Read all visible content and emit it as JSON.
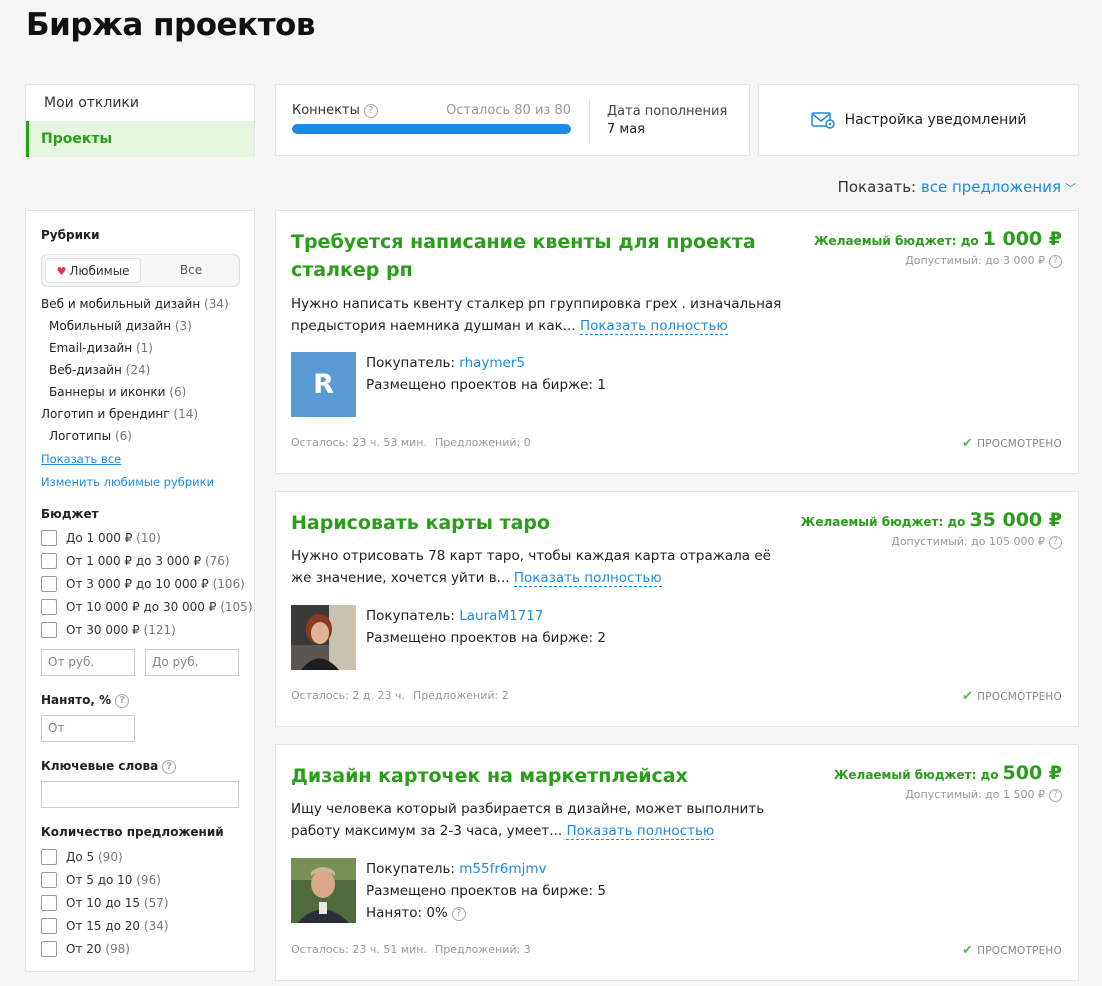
{
  "page_title": "Биржа проектов",
  "nav": {
    "items": [
      "Мои отклики",
      "Проекты"
    ],
    "active_index": 1
  },
  "connects": {
    "label": "Коннекты",
    "remaining_text": "Осталось",
    "remaining": "80 из 80",
    "progress_fraction": 1.0,
    "refill_label": "Дата пополнения",
    "refill_date": "7 мая"
  },
  "notifications": {
    "label": "Настройка уведомлений",
    "icon": "envelope-gear-icon"
  },
  "show": {
    "label": "Показать:",
    "value": "все предложения"
  },
  "filters": {
    "rubrics_title": "Рубрики",
    "tab_favorite": "Любимые",
    "tab_all": "Все",
    "rubrics": [
      {
        "name": "Веб и мобильный дизайн",
        "count": "(34)",
        "sub": false
      },
      {
        "name": "Мобильный дизайн",
        "count": "(3)",
        "sub": true
      },
      {
        "name": "Email-дизайн",
        "count": "(1)",
        "sub": true
      },
      {
        "name": "Веб-дизайн",
        "count": "(24)",
        "sub": true
      },
      {
        "name": "Баннеры и иконки",
        "count": "(6)",
        "sub": true
      },
      {
        "name": "Логотип и брендинг",
        "count": "(14)",
        "sub": false
      },
      {
        "name": "Логотипы",
        "count": "(6)",
        "sub": true
      }
    ],
    "show_all": "Показать все",
    "change_fav": "Изменить любимые рубрики",
    "budget_title": "Бюджет",
    "budget_options": [
      {
        "label": "До 1 000 ₽",
        "count": "(10)"
      },
      {
        "label": "От 1 000 ₽ до 3 000 ₽",
        "count": "(76)"
      },
      {
        "label": "От 3 000 ₽ до 10 000 ₽",
        "count": "(106)"
      },
      {
        "label": "От 10 000 ₽ до 30 000 ₽",
        "count": "(105)"
      },
      {
        "label": "От 30 000 ₽",
        "count": "(121)"
      }
    ],
    "budget_from_placeholder": "От руб.",
    "budget_to_placeholder": "До руб.",
    "hired_title": "Нанято, %",
    "hired_placeholder": "От",
    "keywords_title": "Ключевые слова",
    "offers_title": "Количество предложений",
    "offers_options": [
      {
        "label": "До 5",
        "count": "(90)"
      },
      {
        "label": "От 5 до 10",
        "count": "(96)"
      },
      {
        "label": "От 10 до 15",
        "count": "(57)"
      },
      {
        "label": "От 15 до 20",
        "count": "(34)"
      },
      {
        "label": "От 20",
        "count": "(98)"
      }
    ]
  },
  "projects": [
    {
      "title": "Требуется написание квенты для проекта сталкер рп",
      "budget_label": "Желаемый бюджет: до",
      "budget_value": "1 000 ₽",
      "allowed": "Допустимый: до 3 000 ₽",
      "description": "Нужно написать квенту сталкер рп группировка грех . изначальная предыстория наемника душман и как...",
      "more": "Показать полностью",
      "buyer_label": "Покупатель:",
      "buyer": "rhaymer5",
      "avatar_letter": "R",
      "placed": "Размещено проектов на бирже: 1",
      "hired": "",
      "time_left": "Осталось: 23 ч. 53 мин.",
      "offers": "Предложений: 0",
      "status": "ПРОСМОТРЕНО"
    },
    {
      "title": "Нарисовать карты таро",
      "budget_label": "Желаемый бюджет: до",
      "budget_value": "35 000 ₽",
      "allowed": "Допустимый: до 105 000 ₽",
      "description": "Нужно отрисовать 78 карт таро, чтобы каждая карта отражала её же значение, хочется уйти в...",
      "more": "Показать полностью",
      "buyer_label": "Покупатель:",
      "buyer": "LauraM1717",
      "avatar_letter": "",
      "placed": "Размещено проектов на бирже: 2",
      "hired": "",
      "time_left": "Осталось: 2 д. 23 ч.",
      "offers": "Предложений: 2",
      "status": "ПРОСМОТРЕНО"
    },
    {
      "title": "Дизайн карточек на маркетплейсах",
      "budget_label": "Желаемый бюджет: до",
      "budget_value": "500 ₽",
      "allowed": "Допустимый: до 1 500 ₽",
      "description": "Ищу человека который разбирается в дизайне, может выполнить работу максимум за 2-3 часа, умеет...",
      "more": "Показать полностью",
      "buyer_label": "Покупатель:",
      "buyer": "m55fr6mjmv",
      "avatar_letter": "",
      "placed": "Размещено проектов на бирже: 5",
      "hired": "Нанято: 0%",
      "time_left": "Осталось: 23 ч. 51 мин.",
      "offers": "Предложений: 3",
      "status": "ПРОСМОТРЕНО"
    }
  ]
}
